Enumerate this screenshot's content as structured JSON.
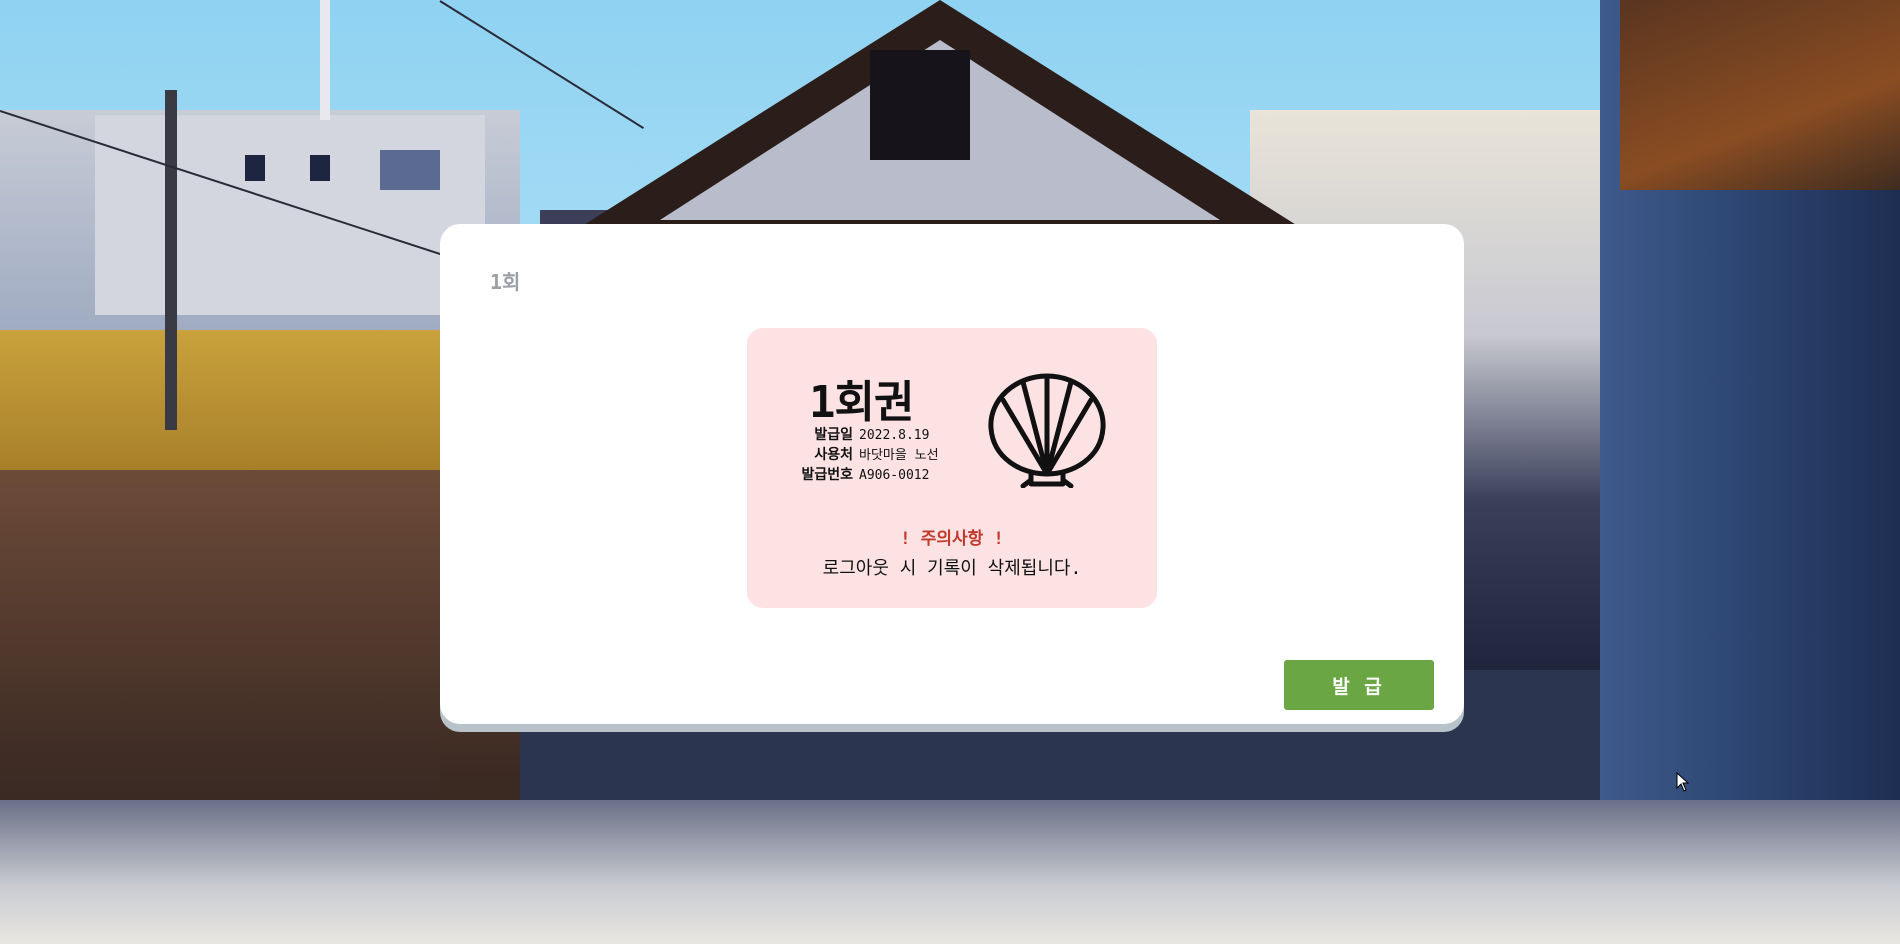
{
  "modal": {
    "title": "1회",
    "issue_button_label": "발 급"
  },
  "ticket": {
    "name": "1회권",
    "fields": [
      {
        "label": "발급일",
        "value": "2022.8.19"
      },
      {
        "label": "사용처",
        "value": "바닷마을 노선"
      },
      {
        "label": "발급번호",
        "value": "A906-0012"
      }
    ],
    "icon": "shell-icon",
    "caution_title": "! 주의사항 !",
    "caution_text": "로그아웃 시 기록이 삭제됩니다.",
    "background_color": "#fde2e4"
  },
  "colors": {
    "issue_button": "#6aa744",
    "caution_title": "#c0392b"
  }
}
